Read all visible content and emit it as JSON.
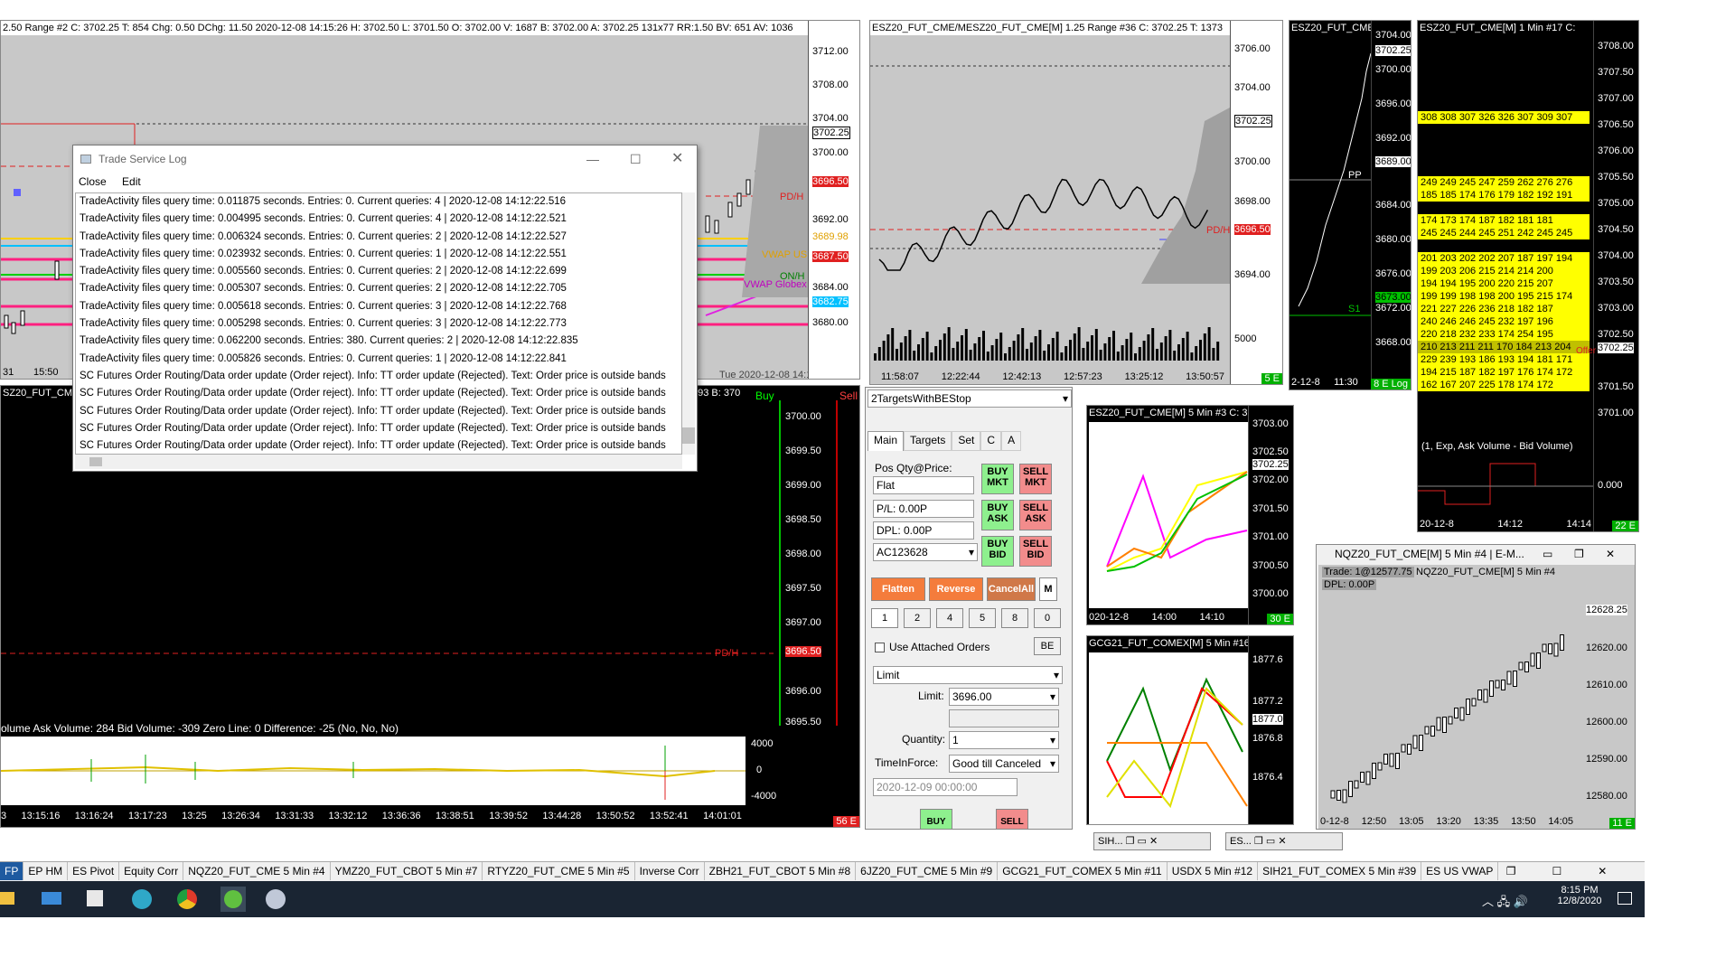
{
  "colors": {
    "chart_bg": "#c8c8c8",
    "dark": "#000000",
    "green": "#00ff00",
    "red": "#ff0000",
    "yellow": "#ffff00",
    "cyan": "#00c0c0",
    "accent": "#1e5aa0"
  },
  "chart1": {
    "header": "2.50 Range  #2 C: 3702.25 T: 854 Chg: 0.50 DChg: 11.50 2020-12-08 14:15:26 H: 3702.50 L: 3701.50 O: 3702.00 V: 1687 B: 3702.00 A: 3702.25 131x77 RR:1.50 BV: 651 AV: 1036",
    "prices": [
      "3712.00",
      "3708.00",
      "3704.00",
      "3702.25",
      "3700.00",
      "3696.50",
      "3692.00",
      "3689.98",
      "3687.50",
      "3684.00",
      "3682.75",
      "3680.00"
    ],
    "tags": {
      "pdh": "PD/H",
      "vwap_us": "VWAP US",
      "onh": "ON/H",
      "vwap_globex": "VWAP Globex"
    },
    "times": [
      "31",
      "15:50"
    ],
    "footer_time": "Tue 2020-12-08  14:14:0"
  },
  "log": {
    "title": "Trade Service Log",
    "menu": [
      "Close",
      "Edit"
    ],
    "lines": [
      "TradeActivity files query time: 0.011875 seconds. Entries: 0. Current queries: 4 | 2020-12-08  14:12:22.516",
      "TradeActivity files query time: 0.004995 seconds. Entries: 0. Current queries: 4 | 2020-12-08  14:12:22.521",
      "TradeActivity files query time: 0.006324 seconds. Entries: 0. Current queries: 2 | 2020-12-08  14:12:22.527",
      "TradeActivity files query time: 0.023932 seconds. Entries: 0. Current queries: 1 | 2020-12-08  14:12:22.551",
      "TradeActivity files query time: 0.005560 seconds. Entries: 0. Current queries: 2 | 2020-12-08  14:12:22.699",
      "TradeActivity files query time: 0.005307 seconds. Entries: 0. Current queries: 2 | 2020-12-08  14:12:22.705",
      "TradeActivity files query time: 0.005618 seconds. Entries: 0. Current queries: 3 | 2020-12-08  14:12:22.768",
      "TradeActivity files query time: 0.005298 seconds. Entries: 0. Current queries: 3 | 2020-12-08  14:12:22.773",
      "TradeActivity files query time: 0.062200 seconds. Entries: 380. Current queries: 2 | 2020-12-08  14:12:22.835",
      "TradeActivity files query time: 0.005826 seconds. Entries: 0. Current queries: 1 | 2020-12-08  14:12:22.841",
      "SC Futures Order Routing/Data order update (Order reject). Info: TT order update (Rejected). Text: Order price is outside bands",
      "SC Futures Order Routing/Data order update (Order reject). Info: TT order update (Rejected). Text: Order price is outside bands",
      "SC Futures Order Routing/Data order update (Order reject). Info: TT order update (Rejected). Text: Order price is outside bands",
      "SC Futures Order Routing/Data order update (Order reject). Info: TT order update (Rejected). Text: Order price is outside bands",
      "SC Futures Order Routing/Data order update (Order reject). Info: TT order update (Rejected). Text: Order price is outside bands"
    ]
  },
  "chart2": {
    "header": "ESZ20_FUT_CME/MESZ20_FUT_CME[M]  1.25 Range  #36 C: 3702.25 T: 1373",
    "prices": [
      "3706.00",
      "3704.00",
      "3702.25",
      "3700.00",
      "3698.00",
      "3696.50",
      "3694.00",
      "5000"
    ],
    "pdh": "PD/H",
    "times": [
      "11:58:07",
      "12:22:44",
      "12:42:13",
      "12:57:23",
      "13:25:12",
      "13:50:57"
    ],
    "badge": "5 E"
  },
  "chart3": {
    "header": "ESZ20_FUT_CME",
    "prices": [
      "3704.00",
      "3702.25",
      "3700.00",
      "3696.00",
      "3692.00",
      "3689.00",
      "3684.00",
      "3680.00",
      "3676.00",
      "3672.00",
      "3668.00"
    ],
    "pp": "PP",
    "s1": "S1",
    "s1_price": "3673.00",
    "times": [
      "2-12-8",
      "11:30"
    ],
    "badge": "8 E Log"
  },
  "chart4": {
    "header": "ESZ20_FUT_CME[M]  1 Min  #17 C:",
    "prices": [
      "3708.00",
      "3707.50",
      "3707.00",
      "3706.50",
      "3706.00",
      "3705.50",
      "3705.00",
      "3704.50",
      "3704.00",
      "3703.50",
      "3703.00",
      "3702.50",
      "3702.25",
      "3701.50",
      "3701.00",
      "0.000"
    ],
    "study": "(1, Exp, Ask Volume - Bid Volume)",
    "times": [
      "20-12-8",
      "14:12",
      "14:14"
    ],
    "badge": "22 E",
    "offer": "Offer"
  },
  "chart5": {
    "header": "SZ20_FUT_CME",
    "header_right": "593 B: 370",
    "buy": "Buy",
    "sell": "Sell",
    "prices": [
      "3700.00",
      "3699.50",
      "3699.00",
      "3698.50",
      "3698.00",
      "3697.50",
      "3697.00",
      "3696.50",
      "3696.00",
      "3695.50"
    ],
    "pdh": "PD/H",
    "study": "olume  Ask Volume: 284  Bid Volume: -309  Zero Line: 0  Difference: -25   (No, No, No)",
    "study_axis": [
      "4000",
      "0",
      "-4000"
    ],
    "times": [
      "3",
      "13:15:16",
      "13:16:24",
      "13:17:23",
      "13:25",
      "13:26:34",
      "13:31:33",
      "13:32:12",
      "13:36:36",
      "13:38:51",
      "13:39:52",
      "13:44:28",
      "13:50:52",
      "13:52:41",
      "14:01:01"
    ],
    "badge": "56 E"
  },
  "trade": {
    "strategy": "2TargetsWithBEStop",
    "tabs": [
      "Main",
      "Targets",
      "Set",
      "C",
      "A"
    ],
    "pos_label": "Pos Qty@Price:",
    "pos_value": "Flat",
    "pl": "P/L: 0.00P",
    "dpl": "DPL: 0.00P",
    "account": "AC123628",
    "buy_mkt": "BUY MKT",
    "sell_mkt": "SELL MKT",
    "buy_ask": "BUY ASK",
    "sell_ask": "SELL ASK",
    "buy_bid": "BUY BID",
    "sell_bid": "SELL BID",
    "flatten": "Flatten",
    "reverse": "Reverse",
    "cancel_all": "CancelAll",
    "m": "M",
    "qty_buttons": [
      "1",
      "2",
      "4",
      "5",
      "8",
      "0"
    ],
    "attached": "Use Attached Orders",
    "be": "BE",
    "order_type": "Limit",
    "limit_label": "Limit:",
    "limit_value": "3696.00",
    "quantity_label": "Quantity:",
    "quantity_value": "1",
    "tif_label": "TimeInForce:",
    "tif_value": "Good till Canceled",
    "date": "2020-12-09  00:00:00",
    "buy": "BUY",
    "sell": "SELL"
  },
  "chart6": {
    "header": "ESZ20_FUT_CME[M]  5 Min  #3 C: 370",
    "prices": [
      "3703.00",
      "3702.50",
      "3702.25",
      "3702.00",
      "3701.50",
      "3701.00",
      "3700.50",
      "3700.00"
    ],
    "times": [
      "020-12-8",
      "14:00",
      "14:10"
    ],
    "badge": "30 E"
  },
  "chart7": {
    "header": "GCG21_FUT_COMEX[M]  5 Min  #16",
    "prices": [
      "1877.6",
      "1877.2",
      "1877.0",
      "1876.8",
      "1876.4"
    ]
  },
  "chart8": {
    "title": "NQZ20_FUT_CME[M]  5 Min  #4 | E-M...",
    "header": "NQZ20_FUT_CME[M]  5 Min  #4",
    "trade": "Trade: 1@12577.75",
    "dpl": "DPL: 0.00P",
    "prices": [
      "12628.25",
      "12620.00",
      "12610.00",
      "12600.00",
      "12590.00",
      "12580.00"
    ],
    "times": [
      "0-12-8",
      "12:50",
      "13:05",
      "13:20",
      "13:35",
      "13:50",
      "14:05"
    ],
    "badge": "11 E"
  },
  "mini_windows": [
    "SIH...",
    "ES..."
  ],
  "taskbar": [
    "FP",
    "EP HM",
    "ES Pivot",
    "Equity Corr",
    "NQZ20_FUT_CME  5 Min  #4",
    "YMZ20_FUT_CBOT  5 Min  #7",
    "RTYZ20_FUT_CME  5 Min  #5",
    "Inverse Corr",
    "ZBH21_FUT_CBOT  5 Min  #8",
    "6JZ20_FUT_CME  5 Min  #9",
    "GCG21_FUT_COMEX  5 Min  #11",
    "USDX  5 Min  #12",
    "SIH21_FUT_COMEX  5 Min  #39",
    "ES US VWAP"
  ],
  "clock": {
    "time": "8:15 PM",
    "date": "12/8/2020"
  }
}
